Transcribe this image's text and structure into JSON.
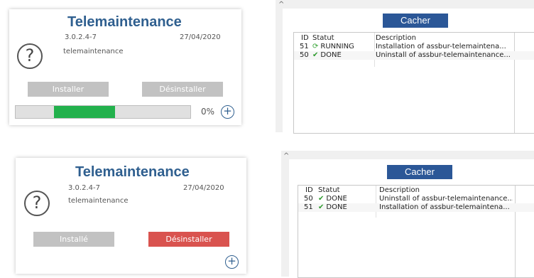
{
  "top": {
    "card": {
      "title": "Telemaintenance",
      "version": "3.0.2.4-7",
      "date": "27/04/2020",
      "package": "telemaintenance",
      "help_glyph": "?",
      "install_label": "Installer",
      "uninstall_label": "Désinstaller",
      "progress_percent": "0%",
      "progress_fill_fraction": 0.35,
      "plus_glyph": "+"
    },
    "panel": {
      "hide_label": "Cacher",
      "headers": {
        "id": "ID",
        "status": "Statut",
        "description": "Description"
      },
      "rows": [
        {
          "id": "51",
          "icon": "running-icon",
          "status": "RUNNING",
          "description": "Installation of assbur-telemaintena..."
        },
        {
          "id": "50",
          "icon": "check-icon",
          "status": "DONE",
          "description": "Uninstall of assbur-telemaintenance..."
        }
      ]
    }
  },
  "bottom": {
    "card": {
      "title": "Telemaintenance",
      "version": "3.0.2.4-7",
      "date": "27/04/2020",
      "package": "telemaintenance",
      "help_glyph": "?",
      "installed_label": "Installé",
      "uninstall_label": "Désinstaller",
      "plus_glyph": "+"
    },
    "panel": {
      "hide_label": "Cacher",
      "headers": {
        "id": "ID",
        "status": "Statut",
        "description": "Description"
      },
      "rows": [
        {
          "id": "50",
          "icon": "check-icon",
          "status": "DONE",
          "description": "Uninstall of assbur-telemaintenance..."
        },
        {
          "id": "51",
          "icon": "check-icon",
          "status": "DONE",
          "description": "Installation of assbur-telemaintena..."
        }
      ]
    }
  },
  "colors": {
    "title": "#2f5f8f",
    "progress": "#22b14c",
    "hide_button": "#2b5797",
    "uninstall_red": "#d9534f",
    "disabled_gray": "#c2c2c2"
  }
}
